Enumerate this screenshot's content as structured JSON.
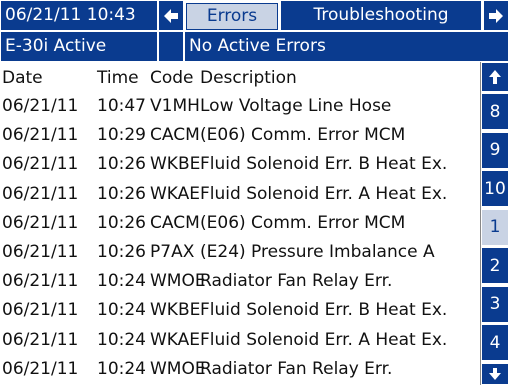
{
  "header": {
    "datetime": "06/21/11 10:43",
    "tabs": [
      "Errors",
      "Troubleshooting"
    ],
    "status_left": "E-30i Active",
    "status_right": "No Active Errors"
  },
  "columns": {
    "date": "Date",
    "time": "Time",
    "code": "Code",
    "description": "Description"
  },
  "rows": [
    {
      "date": "06/21/11",
      "time": "10:47",
      "code": "V1MH",
      "description": "Low Voltage Line Hose"
    },
    {
      "date": "06/21/11",
      "time": "10:29",
      "code": "CACM",
      "description": "(E06) Comm. Error MCM"
    },
    {
      "date": "06/21/11",
      "time": "10:26",
      "code": "WKBE",
      "description": "Fluid Solenoid Err. B Heat Ex."
    },
    {
      "date": "06/21/11",
      "time": "10:26",
      "code": "WKAE",
      "description": "Fluid Solenoid Err. A Heat Ex."
    },
    {
      "date": "06/21/11",
      "time": "10:26",
      "code": "CACM",
      "description": "(E06) Comm. Error MCM"
    },
    {
      "date": "06/21/11",
      "time": "10:26",
      "code": "P7AX",
      "description": "(E24) Pressure Imbalance A"
    },
    {
      "date": "06/21/11",
      "time": "10:24",
      "code": "WMOE",
      "description": "Radiator Fan Relay Err."
    },
    {
      "date": "06/21/11",
      "time": "10:24",
      "code": "WKBE",
      "description": "Fluid Solenoid Err. B Heat Ex."
    },
    {
      "date": "06/21/11",
      "time": "10:24",
      "code": "WKAE",
      "description": "Fluid Solenoid Err. A Heat Ex."
    },
    {
      "date": "06/21/11",
      "time": "10:24",
      "code": "WMOE",
      "description": "Radiator Fan Relay Err."
    }
  ],
  "pages": [
    "8",
    "9",
    "10",
    "1",
    "2",
    "3",
    "4"
  ],
  "selected_page": "1",
  "colors": {
    "accent": "#0a3b8f",
    "selected": "#c9d3e4"
  },
  "icons": [
    "arrow-left-icon",
    "arrow-right-icon",
    "arrow-up-icon",
    "arrow-down-icon"
  ]
}
